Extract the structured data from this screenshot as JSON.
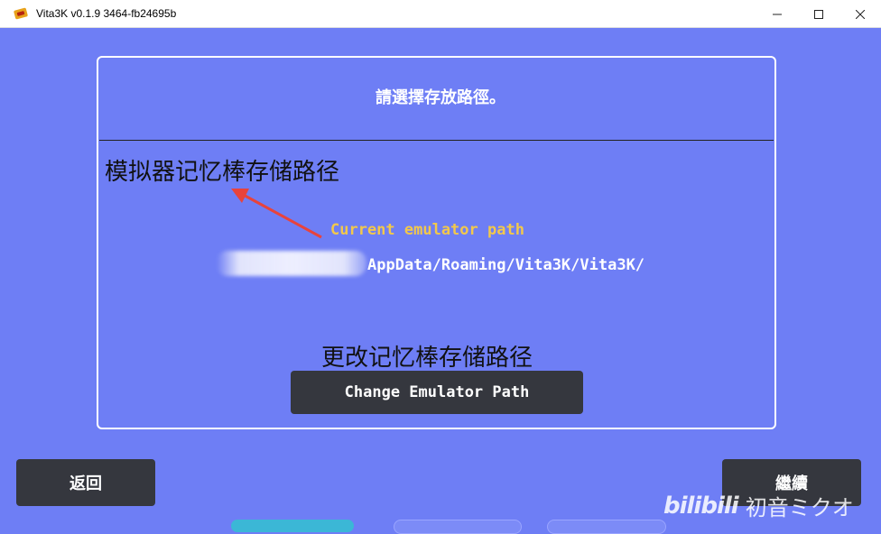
{
  "window": {
    "title": "Vita3K v0.1.9 3464-fb24695b",
    "minimize": "—",
    "maximize": "☐",
    "close": "✕"
  },
  "panel": {
    "title": "請選擇存放路徑。",
    "current_label": "Current emulator path",
    "path_suffix": "AppData/Roaming/Vita3K/Vita3K/",
    "change_button": "Change Emulator Path"
  },
  "annotations": {
    "memory_stick_path": "模拟器记忆棒存储路径",
    "change_memory_stick_path": "更改记忆棒存储路径",
    "arrow_color": "#e8433c"
  },
  "nav": {
    "back": "返回",
    "next": "繼續"
  },
  "watermark": {
    "logo": "bilibili",
    "author": "初音ミクオ"
  },
  "colors": {
    "background": "#6e7ef5",
    "button": "#35373e",
    "label_yellow": "#f2c84b"
  }
}
